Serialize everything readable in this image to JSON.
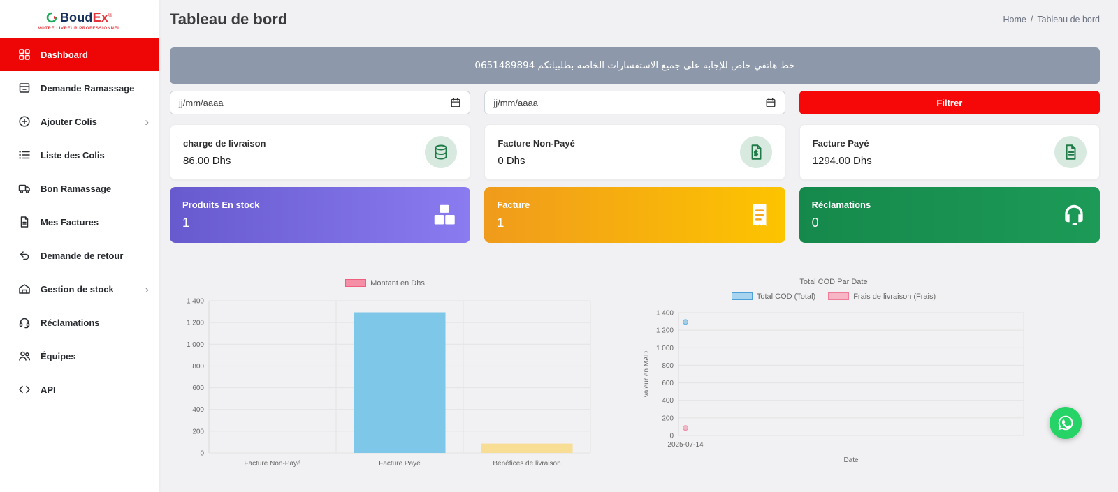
{
  "brand": {
    "name_primary": "Boud",
    "name_accent": "Ex",
    "registered": "®",
    "tagline": "VOTRE LIVREUR PROFESSIONNEL"
  },
  "sidebar": {
    "items": [
      {
        "label": "Dashboard",
        "icon": "dashboard-grid-icon",
        "active": true
      },
      {
        "label": "Demande Ramassage",
        "icon": "pickup-request-icon"
      },
      {
        "label": "Ajouter Colis",
        "icon": "add-parcel-icon",
        "chevron": "›"
      },
      {
        "label": "Liste des Colis",
        "icon": "parcel-list-icon"
      },
      {
        "label": "Bon Ramassage",
        "icon": "pickup-slip-icon"
      },
      {
        "label": "Mes Factures",
        "icon": "invoices-icon"
      },
      {
        "label": "Demande de retour",
        "icon": "return-request-icon"
      },
      {
        "label": "Gestion de stock",
        "icon": "stock-management-icon",
        "chevron": "›"
      },
      {
        "label": "Réclamations",
        "icon": "claims-icon"
      },
      {
        "label": "Équipes",
        "icon": "teams-icon"
      },
      {
        "label": "API",
        "icon": "api-icon"
      }
    ]
  },
  "header": {
    "title": "Tableau de bord",
    "breadcrumb": {
      "home": "Home",
      "separator": "/",
      "current": "Tableau de bord"
    }
  },
  "banner": {
    "text": "خط هاتفي خاص للإجابة على جميع الاستفسارات الخاصة بطلبياتكم  0651489894"
  },
  "filters": {
    "date_from_placeholder": "jj/mm/aaaa",
    "date_to_placeholder": "jj/mm/aaaa",
    "filter_button_label": "Filtrer"
  },
  "stat_cards": [
    {
      "title": "charge de livraison",
      "value": "86.00 Dhs",
      "icon": "coins-icon"
    },
    {
      "title": "Facture Non-Payé",
      "value": "0 Dhs",
      "icon": "invoice-dollar-icon"
    },
    {
      "title": "Facture Payé",
      "value": "1294.00 Dhs",
      "icon": "paid-invoice-icon"
    }
  ],
  "color_cards": [
    {
      "title": "Produits En stock",
      "value": "1",
      "icon": "parcel-boxes-icon",
      "gradient": [
        "#675ace",
        "#8a7cf0"
      ]
    },
    {
      "title": "Facture",
      "value": "1",
      "icon": "receipt-icon",
      "gradient": [
        "#f09b1c",
        "#fdc400"
      ]
    },
    {
      "title": "Réclamations",
      "value": "0",
      "icon": "headset-icon",
      "gradient": [
        "#15894b",
        "#1d9a57"
      ]
    }
  ],
  "chart_data": [
    {
      "type": "bar",
      "title": "",
      "legend": [
        {
          "label": "Montant en Dhs",
          "fill": "#f48fa5",
          "border": "#ee5f80"
        }
      ],
      "categories": [
        "Facture Non-Payé",
        "Facture Payé",
        "Bénéfices de livraison"
      ],
      "values": [
        0,
        1294,
        86
      ],
      "bar_colors": [
        "#7fc7e8",
        "#7fc7e8",
        "#f8dd95"
      ],
      "ylim": [
        0,
        1400
      ],
      "ytick_step": 200,
      "grid": true,
      "legend_position": "top"
    },
    {
      "type": "line",
      "title": "Total COD Par Date",
      "legend": [
        {
          "label": "Total COD (Total)",
          "fill": "#a9d4ef",
          "border": "#4d9fd8"
        },
        {
          "label": "Frais de livraison (Frais)",
          "fill": "#f7b6c6",
          "border": "#ef7d98"
        }
      ],
      "x": [
        "2025-07-14"
      ],
      "series": [
        {
          "name": "Total COD (Total)",
          "values": [
            1294
          ],
          "color": "#5fb0e0"
        },
        {
          "name": "Frais de livraison (Frais)",
          "values": [
            86
          ],
          "color": "#f287a3"
        }
      ],
      "xlabel": "Date",
      "ylabel": "valeur en MAD",
      "ylim": [
        0,
        1400
      ],
      "ytick_step": 200,
      "grid": true,
      "legend_position": "top"
    }
  ],
  "floating": {
    "whatsapp_button": "whatsapp-icon"
  }
}
